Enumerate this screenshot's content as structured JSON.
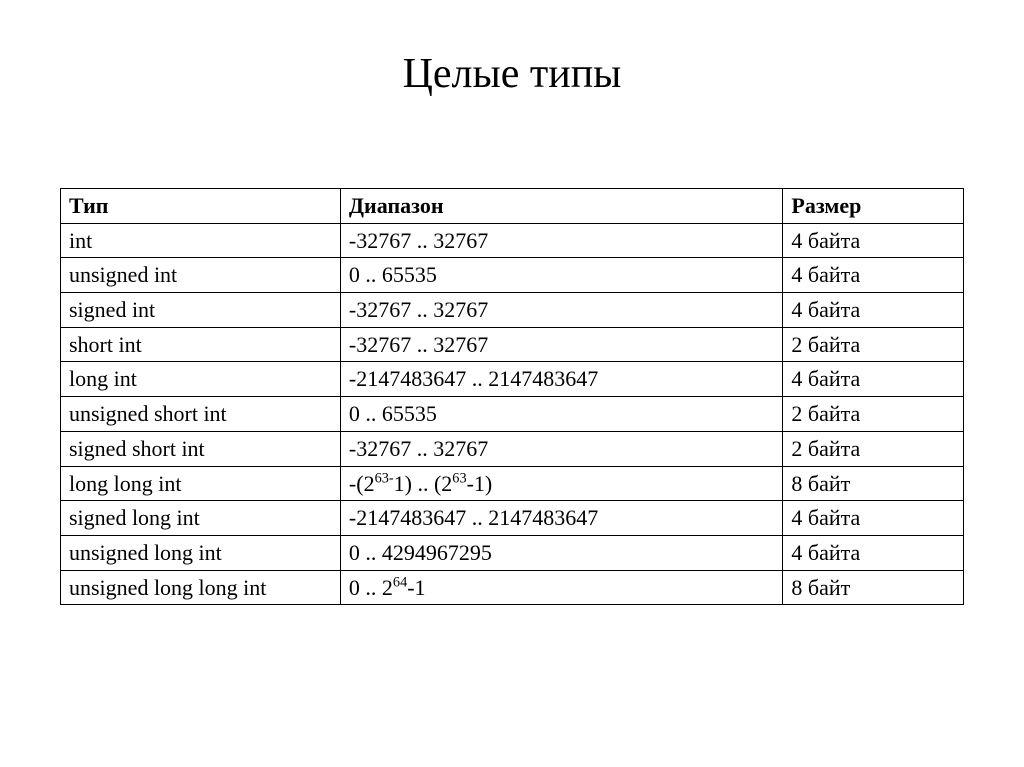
{
  "title": "Целые типы",
  "headers": {
    "type": "Тип",
    "range": "Диапазон",
    "size": "Размер"
  },
  "rows": [
    {
      "type": "int",
      "range": "-32767 .. 32767",
      "size": "4 байта"
    },
    {
      "type": "unsigned int",
      "range": "0 .. 65535",
      "size": "4 байта"
    },
    {
      "type": "signed int",
      "range": "-32767 .. 32767",
      "size": "4 байта"
    },
    {
      "type": "short int",
      "range": "-32767 .. 32767",
      "size": "2 байта"
    },
    {
      "type": "long int",
      "range": "-2147483647 .. 2147483647",
      "size": "4 байта"
    },
    {
      "type": "unsigned short int",
      "range": "0 .. 65535",
      "size": "2 байта"
    },
    {
      "type": "signed short int",
      "range": "-32767 .. 32767",
      "size": "2 байта"
    },
    {
      "type": "long long int",
      "range_html": "-(2<sup>63-</sup>1) .. (2<sup>63</sup>-1)",
      "size": "8 байт"
    },
    {
      "type": "signed long int",
      "range": "-2147483647 .. 2147483647",
      "size": "4 байта"
    },
    {
      "type": "unsigned long int",
      "range": "0 .. 4294967295",
      "size": "4 байта"
    },
    {
      "type": "unsigned long long int",
      "range_html": "0 .. 2<sup>64</sup>-1",
      "size": "8 байт"
    }
  ],
  "chart_data": {
    "type": "table",
    "title": "Целые типы",
    "columns": [
      "Тип",
      "Диапазон",
      "Размер"
    ],
    "rows": [
      [
        "int",
        "-32767 .. 32767",
        "4 байта"
      ],
      [
        "unsigned int",
        "0 .. 65535",
        "4 байта"
      ],
      [
        "signed int",
        "-32767 .. 32767",
        "4 байта"
      ],
      [
        "short int",
        "-32767 .. 32767",
        "2 байта"
      ],
      [
        "long int",
        "-2147483647 .. 2147483647",
        "4 байта"
      ],
      [
        "unsigned short int",
        "0 .. 65535",
        "2 байта"
      ],
      [
        "signed short int",
        "-32767 .. 32767",
        "2 байта"
      ],
      [
        "long long int",
        "-(2^63 - 1) .. (2^63 - 1)",
        "8 байт"
      ],
      [
        "signed long int",
        "-2147483647 .. 2147483647",
        "4 байта"
      ],
      [
        "unsigned long int",
        "0 .. 4294967295",
        "4 байта"
      ],
      [
        "unsigned long long int",
        "0 .. 2^64 - 1",
        "8 байт"
      ]
    ]
  }
}
